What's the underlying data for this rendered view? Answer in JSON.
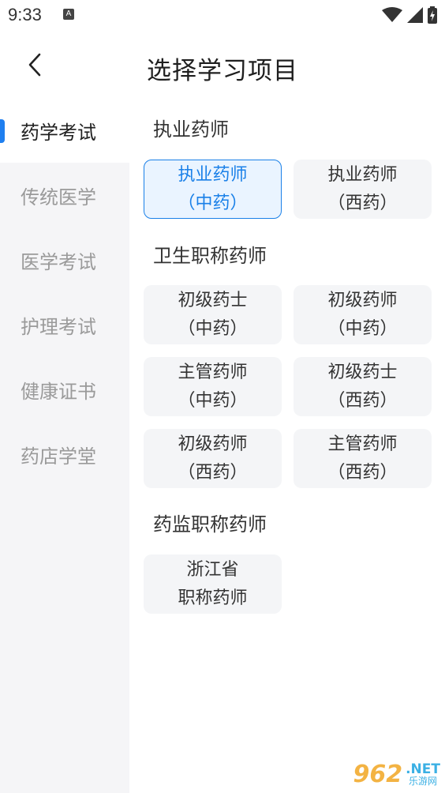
{
  "status": {
    "time": "9:33",
    "notif_letter": "A"
  },
  "header": {
    "title": "选择学习项目"
  },
  "sidebar": {
    "items": [
      {
        "label": "药学考试",
        "active": true
      },
      {
        "label": "传统医学",
        "active": false
      },
      {
        "label": "医学考试",
        "active": false
      },
      {
        "label": "护理考试",
        "active": false
      },
      {
        "label": "健康证书",
        "active": false
      },
      {
        "label": "药店学堂",
        "active": false
      }
    ]
  },
  "sections": [
    {
      "title": "执业药师",
      "cards": [
        {
          "line1": "执业药师",
          "line2": "（中药）",
          "selected": true
        },
        {
          "line1": "执业药师",
          "line2": "（西药）",
          "selected": false
        }
      ]
    },
    {
      "title": "卫生职称药师",
      "cards": [
        {
          "line1": "初级药士",
          "line2": "（中药）"
        },
        {
          "line1": "初级药师",
          "line2": "（中药）"
        },
        {
          "line1": "主管药师",
          "line2": "（中药）"
        },
        {
          "line1": "初级药士",
          "line2": "（西药）"
        },
        {
          "line1": "初级药师",
          "line2": "（西药）"
        },
        {
          "line1": "主管药师",
          "line2": "（西药）"
        }
      ]
    },
    {
      "title": "药监职称药师",
      "cards": [
        {
          "line1": "浙江省",
          "line2": "职称药师"
        }
      ]
    }
  ],
  "colors": {
    "accent": "#1a80e8",
    "sidebar_bg": "#f5f5f7",
    "card_bg": "#f4f5f7"
  },
  "watermark": {
    "num": "962",
    "net": ".NET",
    "cn": "乐游网"
  }
}
